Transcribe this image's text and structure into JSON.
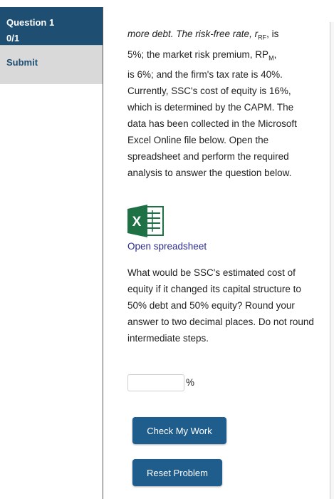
{
  "sidebar": {
    "question_title": "Question 1",
    "score": "0/1",
    "submit_label": "Submit"
  },
  "problem": {
    "line1_prefix": "more debt. The risk-free rate, r",
    "line1_sub": "RF",
    "line1_suffix": ", is",
    "line2_prefix": "5%; the market risk premium, RP",
    "line2_sub": "M",
    "line2_suffix": ",",
    "rest": "is 6%; and the firm's tax rate is 40%. Currently, SSC's cost of equity is 16%, which is determined by the CAPM. The data has been collected in the Microsoft Excel Online file below. Open the spreadsheet and perform the required analysis to answer the question below."
  },
  "spreadsheet": {
    "icon_letter": "X",
    "link_text": "Open spreadsheet"
  },
  "question": {
    "text": "What would be SSC's estimated cost of equity if it changed its capital structure to 50% debt and 50% equity? Round your answer to two decimal places. Do not round intermediate steps."
  },
  "answer": {
    "value": "",
    "unit": "%"
  },
  "buttons": {
    "check_label": "Check My Work",
    "reset_label": "Reset Problem"
  },
  "colors": {
    "sidebar_header": "#1f4e73",
    "sidebar_submit_bg": "#d9d9d9",
    "button_bg": "#1f5d8c",
    "link": "#2a2a8c",
    "excel_green": "#1e7145"
  }
}
